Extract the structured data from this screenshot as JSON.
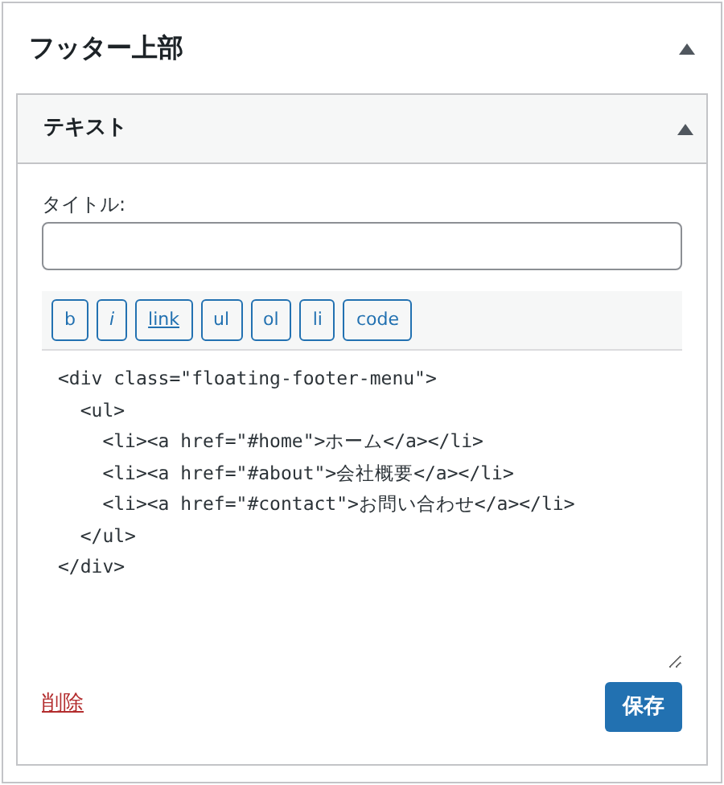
{
  "sidebar": {
    "title": "フッター上部",
    "expanded": true
  },
  "widget": {
    "title": "テキスト",
    "expanded": true,
    "title_field": {
      "label": "タイトル:"
    },
    "toolbar": [
      {
        "label": "b",
        "kind": "plain"
      },
      {
        "label": "i",
        "kind": "italic"
      },
      {
        "label": "link",
        "kind": "underline"
      },
      {
        "label": "ul",
        "kind": "plain"
      },
      {
        "label": "ol",
        "kind": "plain"
      },
      {
        "label": "li",
        "kind": "plain"
      },
      {
        "label": "code",
        "kind": "plain"
      }
    ],
    "code_lines": [
      "<div class=\"floating-footer-menu\">",
      "  <ul>",
      "    <li><a href=\"#home\">ホーム</a></li>",
      "    <li><a href=\"#about\">会社概要</a></li>",
      "    <li><a href=\"#contact\">お問い合わせ</a></li>",
      "  </ul>",
      "</div>"
    ],
    "delete_link": "削除",
    "save_button": "保存"
  }
}
